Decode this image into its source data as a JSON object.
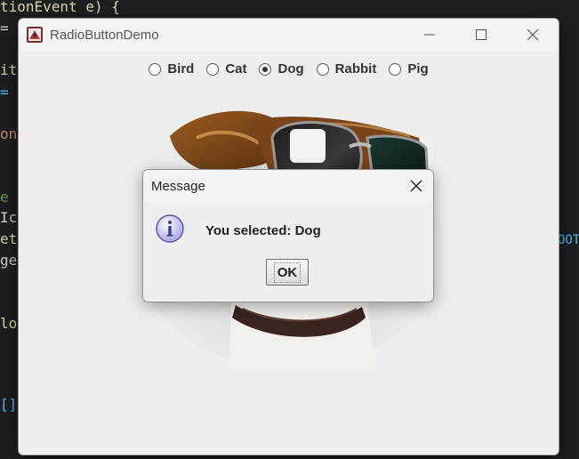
{
  "code_editor": {
    "lines": [
      {
        "text": "tionEvent e) {",
        "cls": "c-yellow"
      },
      {
        "text": "= n",
        "cls": "c-white"
      },
      {
        "text": "it.",
        "cls": "c-yellow"
      },
      {
        "text": "= p",
        "cls": "c-blue"
      },
      {
        "text": "ong",
        "cls": "c-orange"
      },
      {
        "text": "e",
        "cls": "c-green"
      },
      {
        "text": "Ico",
        "cls": "c-white"
      },
      {
        "text": "eti",
        "cls": "c-yellow"
      },
      {
        "text": "ge)",
        "cls": "c-white"
      },
      {
        "text": "log",
        "cls": "c-yellow"
      },
      {
        "text": "[]",
        "cls": "c-blue"
      }
    ],
    "right_fragment": "OOT"
  },
  "window": {
    "title": "RadioButtonDemo",
    "icon": "java-app-icon",
    "controls": [
      "minimize-icon",
      "maximize-icon",
      "close-icon"
    ]
  },
  "radio_buttons": [
    {
      "label": "Bird",
      "checked": false
    },
    {
      "label": "Cat",
      "checked": false
    },
    {
      "label": "Dog",
      "checked": true
    },
    {
      "label": "Rabbit",
      "checked": false
    },
    {
      "label": "Pig",
      "checked": false
    }
  ],
  "image": {
    "subject": "dog-with-sunglasses"
  },
  "dialog": {
    "title": "Message",
    "icon": "info-icon",
    "message": "You selected: Dog",
    "ok_label": "OK"
  }
}
